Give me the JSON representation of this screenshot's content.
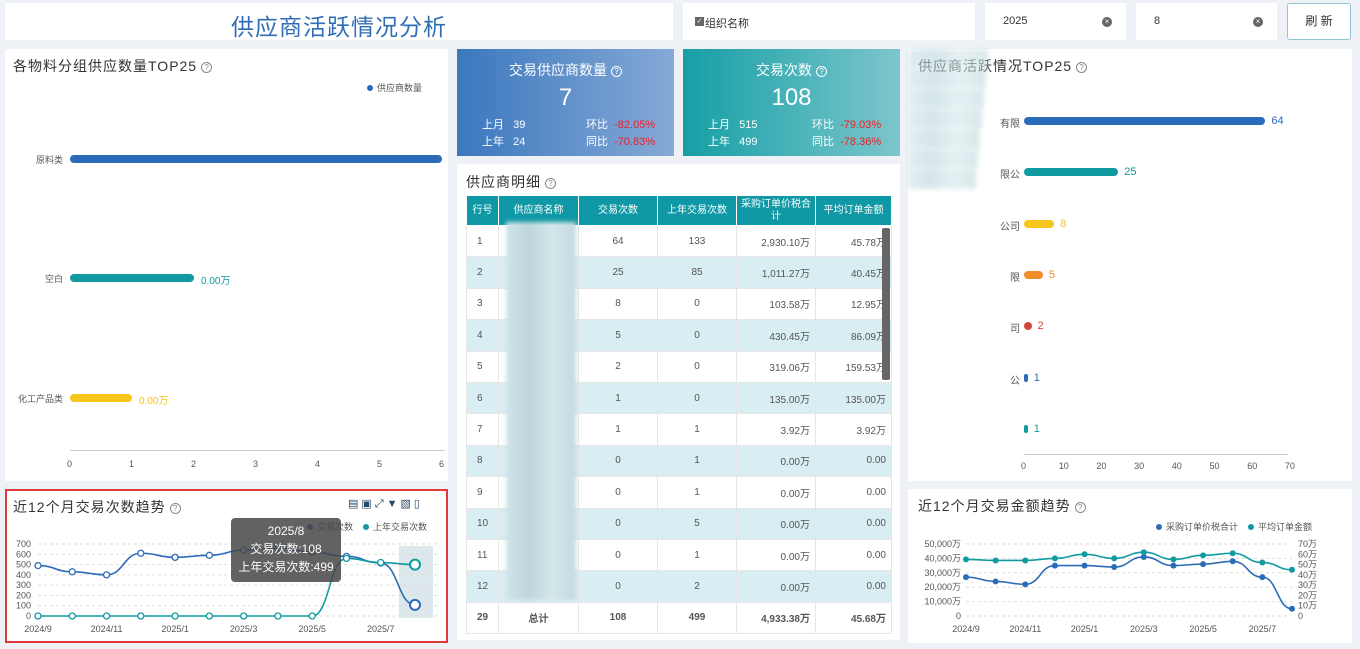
{
  "header": {
    "title": "供应商活跃情况分析"
  },
  "filters": {
    "org_label": "组织名称",
    "year": "2025",
    "month": "8",
    "refresh": "刷 新"
  },
  "material_top": {
    "title": "各物料分组供应数量TOP25",
    "legend": "供应商数量",
    "color": "#2c6bb8",
    "categories": [
      "原料类",
      "空白",
      "化工产品类"
    ],
    "bar_labels": [
      "",
      "0.00万",
      "0.00万"
    ],
    "bar_colors": [
      "#2c6bb8",
      "#0f9ba0",
      "#f7c51c"
    ],
    "x_ticks": [
      "0",
      "1",
      "2",
      "3",
      "4",
      "5",
      "6"
    ]
  },
  "kpi_supplier": {
    "title": "交易供应商数量",
    "value": "7",
    "last_month_label": "上月",
    "last_month": "39",
    "mom_label": "环比",
    "mom": "-82.05%",
    "last_year_label": "上年",
    "last_year": "24",
    "yoy_label": "同比",
    "yoy": "-70.83%"
  },
  "kpi_trades": {
    "title": "交易次数",
    "value": "108",
    "last_month_label": "上月",
    "last_month": "515",
    "mom_label": "环比",
    "mom": "-79.03%",
    "last_year_label": "上年",
    "last_year": "499",
    "yoy_label": "同比",
    "yoy": "-78.36%"
  },
  "detail": {
    "title": "供应商明细",
    "columns": [
      "行号",
      "供应商名称",
      "交易次数",
      "上年交易次数",
      "采购订单价税合计",
      "平均订单金额"
    ],
    "rows": [
      [
        "1",
        "64",
        "133",
        "2,930.10万",
        "45.78万"
      ],
      [
        "2",
        "25",
        "85",
        "1,011.27万",
        "40.45万"
      ],
      [
        "3",
        "8",
        "0",
        "103.58万",
        "12.95万"
      ],
      [
        "4",
        "5",
        "0",
        "430.45万",
        "86.09万"
      ],
      [
        "5",
        "2",
        "0",
        "319.06万",
        "159.53万"
      ],
      [
        "6",
        "1",
        "0",
        "135.00万",
        "135.00万"
      ],
      [
        "7",
        "1",
        "1",
        "3.92万",
        "3.92万"
      ],
      [
        "8",
        "0",
        "1",
        "0.00万",
        "0.00"
      ],
      [
        "9",
        "0",
        "1",
        "0.00万",
        "0.00"
      ],
      [
        "10",
        "0",
        "5",
        "0.00万",
        "0.00"
      ],
      [
        "11",
        "0",
        "1",
        "0.00万",
        "0.00"
      ],
      [
        "12",
        "0",
        "2",
        "0.00万",
        "0.00"
      ]
    ],
    "total": [
      "29",
      "总计",
      "108",
      "499",
      "4,933.38万",
      "45.68万"
    ]
  },
  "supplier_top": {
    "title": "供应商活跃情况TOP25",
    "name_fragments": [
      "有限",
      "限公",
      "公司",
      "限",
      "司",
      "公",
      ""
    ],
    "values": [
      64,
      25,
      8,
      5,
      2,
      1,
      1
    ],
    "colors": [
      "#2c6bb8",
      "#0f9ba0",
      "#f7c51c",
      "#f28c28",
      "#d4473b",
      "#2c6bb8",
      "#0f9ba0"
    ],
    "x_ticks": [
      "0",
      "10",
      "20",
      "30",
      "40",
      "50",
      "60",
      "70"
    ]
  },
  "trend_count": {
    "title": "近12个月交易次数趋势",
    "legend": [
      "交易次数",
      "上年交易次数"
    ],
    "tooltip": {
      "title": "2025/8",
      "line1": "交易次数:108",
      "line2": "上年交易次数:499"
    },
    "y_ticks": [
      "700",
      "600",
      "500",
      "400",
      "300",
      "200",
      "100",
      "0"
    ],
    "x_labels": [
      "2024/9",
      "2024/11",
      "2025/1",
      "2025/3",
      "2025/5",
      "2025/7"
    ],
    "chart_data": {
      "type": "line",
      "x": [
        "2024/9",
        "2024/10",
        "2024/11",
        "2024/12",
        "2025/1",
        "2025/2",
        "2025/3",
        "2025/4",
        "2025/5",
        "2025/6",
        "2025/7",
        "2025/8"
      ],
      "series": [
        {
          "name": "交易次数",
          "values": [
            490,
            430,
            400,
            610,
            570,
            590,
            640,
            660,
            620,
            580,
            515,
            108
          ]
        },
        {
          "name": "上年交易次数",
          "values": [
            0,
            0,
            0,
            0,
            0,
            0,
            0,
            0,
            0,
            560,
            520,
            499
          ]
        }
      ],
      "ylim": [
        0,
        700
      ]
    }
  },
  "trend_amount": {
    "title": "近12个月交易金额趋势",
    "legend": [
      "采购订单价税合计",
      "平均订单金额"
    ],
    "y_left": [
      "50,000万",
      "40,000万",
      "30,000万",
      "20,000万",
      "10,000万",
      "0"
    ],
    "y_right": [
      "70万",
      "60万",
      "50万",
      "40万",
      "30万",
      "20万",
      "10万",
      "0"
    ],
    "x_labels": [
      "2024/9",
      "2024/11",
      "2025/1",
      "2025/3",
      "2025/5",
      "2025/7"
    ],
    "chart_data": {
      "type": "line",
      "x": [
        "2024/9",
        "2024/10",
        "2024/11",
        "2024/12",
        "2025/1",
        "2025/2",
        "2025/3",
        "2025/4",
        "2025/5",
        "2025/6",
        "2025/7",
        "2025/8"
      ],
      "series": [
        {
          "name": "采购订单价税合计",
          "axis": "left",
          "values": [
            27000,
            24000,
            22000,
            35000,
            35000,
            34000,
            41000,
            35000,
            36000,
            38000,
            27000,
            5000
          ]
        },
        {
          "name": "平均订单金额",
          "axis": "right",
          "values": [
            55,
            54,
            54,
            56,
            60,
            56,
            62,
            55,
            59,
            61,
            52,
            45
          ]
        }
      ],
      "ylim_left": [
        0,
        50000
      ],
      "ylim_right": [
        0,
        70
      ]
    }
  },
  "colors": {
    "blue": "#2c6bb8",
    "teal": "#0f9ba0",
    "red": "#e8202a",
    "highlight_border": "#e03a3a"
  }
}
